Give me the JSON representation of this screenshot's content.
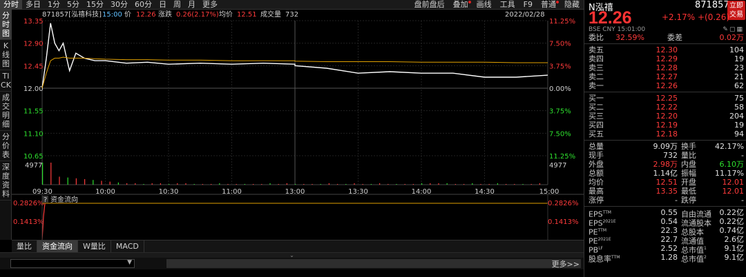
{
  "toolbar": {
    "tabs": [
      "分时",
      "多日",
      "1分",
      "5分",
      "15分",
      "30分",
      "60分",
      "日",
      "周",
      "月",
      "更多"
    ],
    "right": [
      "盘前盘后",
      "叠加",
      "画线",
      "工具",
      "F9",
      "普通",
      "隐藏"
    ]
  },
  "sidebar": [
    "分时图",
    "K线图",
    "TICK",
    "成交明细",
    "分价表",
    "深度资料"
  ],
  "chart_header": {
    "code_name": "871857[泓禧科技]",
    "time": "15:00",
    "price_label": "价",
    "price": "12.26",
    "change_label": "涨跌",
    "change": "0.26(2.17%)",
    "avg_label": "均价",
    "avg": "12.51",
    "vol_label": "成交量",
    "vol": "732",
    "date": "2022/02/28"
  },
  "axes": {
    "price_ticks": [
      "13.35",
      "12.90",
      "12.45",
      "12.00",
      "11.55",
      "11.10",
      "10.65"
    ],
    "pct_ticks": [
      "11.25%",
      "7.50%",
      "3.75%",
      "0.00%",
      "3.75%",
      "7.50%",
      "11.25%"
    ],
    "vol_tick": "4977",
    "time_ticks": [
      "09:30",
      "10:00",
      "10:30",
      "11:00",
      "13:00",
      "13:30",
      "14:00",
      "14:30",
      "15:00"
    ]
  },
  "chart_data": {
    "type": "line",
    "title": "",
    "ylim": [
      10.65,
      13.35
    ],
    "x": [
      "09:30",
      "09:32",
      "09:34",
      "09:36",
      "09:38",
      "09:40",
      "09:43",
      "09:46",
      "09:50",
      "09:55",
      "10:00",
      "10:10",
      "10:20",
      "10:30",
      "10:45",
      "11:00",
      "11:15",
      "11:30",
      "13:00",
      "13:15",
      "13:30",
      "13:45",
      "14:00",
      "14:15",
      "14:30",
      "14:45",
      "15:00"
    ],
    "series": [
      {
        "name": "价",
        "color": "#ffffff",
        "values": [
          12.0,
          12.6,
          13.3,
          12.9,
          12.75,
          12.9,
          12.35,
          12.7,
          12.6,
          12.55,
          12.55,
          12.5,
          12.52,
          12.48,
          12.5,
          12.48,
          12.5,
          12.48,
          12.45,
          12.4,
          12.3,
          12.33,
          12.3,
          12.3,
          12.22,
          12.22,
          12.26
        ]
      },
      {
        "name": "均价",
        "color": "#e0a000",
        "values": [
          12.0,
          12.3,
          12.55,
          12.6,
          12.6,
          12.62,
          12.6,
          12.6,
          12.6,
          12.59,
          12.58,
          12.57,
          12.57,
          12.56,
          12.56,
          12.55,
          12.55,
          12.55,
          12.54,
          12.53,
          12.53,
          12.53,
          12.52,
          12.52,
          12.52,
          12.51,
          12.51
        ]
      }
    ]
  },
  "fund_flow": {
    "help": "?",
    "title": "资金流向",
    "ticks": [
      "0.2826%",
      "0.1413%"
    ]
  },
  "bottom_tabs": [
    "量比",
    "资金流向",
    "W量比",
    "MACD"
  ],
  "bottombar": {
    "more": "更多>>"
  },
  "quote": {
    "name": "N泓禧",
    "code": "871857",
    "btn": "立即交易",
    "price": "12.26",
    "change": "+2.17% +(0.26)",
    "sub": "BSE  CNY  15:01:00",
    "weibi_label": "委比",
    "weibi": "32.59%",
    "weicha_label": "委差",
    "weicha": "0.02万",
    "asks": [
      {
        "label": "卖五",
        "price": "12.30",
        "vol": "104"
      },
      {
        "label": "卖四",
        "price": "12.29",
        "vol": "19"
      },
      {
        "label": "卖三",
        "price": "12.28",
        "vol": "23"
      },
      {
        "label": "卖二",
        "price": "12.27",
        "vol": "21"
      },
      {
        "label": "卖一",
        "price": "12.26",
        "vol": "62"
      }
    ],
    "bids": [
      {
        "label": "买一",
        "price": "12.25",
        "vol": "75"
      },
      {
        "label": "买二",
        "price": "12.22",
        "vol": "58"
      },
      {
        "label": "买三",
        "price": "12.20",
        "vol": "204"
      },
      {
        "label": "买四",
        "price": "12.19",
        "vol": "19"
      },
      {
        "label": "买五",
        "price": "12.18",
        "vol": "94"
      }
    ],
    "stats": [
      {
        "l1": "总量",
        "v1": "9.09万",
        "c1": "white",
        "l2": "换手",
        "v2": "42.17%",
        "c2": "white"
      },
      {
        "l1": "现手",
        "v1": "732",
        "c1": "white",
        "l2": "量比",
        "v2": "-",
        "c2": "white"
      },
      {
        "l1": "外盘",
        "v1": "2.98万",
        "c1": "red",
        "l2": "内盘",
        "v2": "6.10万",
        "c2": "green"
      },
      {
        "l1": "总额",
        "v1": "1.14亿",
        "c1": "white",
        "l2": "振幅",
        "v2": "11.17%",
        "c2": "white"
      },
      {
        "l1": "均价",
        "v1": "12.51",
        "c1": "red",
        "l2": "开盘",
        "v2": "12.01",
        "c2": "red"
      },
      {
        "l1": "最高",
        "v1": "13.35",
        "c1": "red",
        "l2": "最低",
        "v2": "12.01",
        "c2": "red"
      },
      {
        "l1": "涨停",
        "v1": "-",
        "c1": "white",
        "l2": "跌停",
        "v2": "-",
        "c2": "white"
      }
    ],
    "fundamentals": [
      {
        "l1": "EPS",
        "s1": "TTM",
        "v1": "0.55",
        "l2": "自由流通",
        "s2": "",
        "v2": "0.22亿"
      },
      {
        "l1": "EPS",
        "s1": "2021E",
        "v1": "0.54",
        "l2": "流通股本",
        "s2": "",
        "v2": "0.22亿"
      },
      {
        "l1": "PE",
        "s1": "TTM",
        "v1": "22.3",
        "l2": "总股本",
        "s2": "",
        "v2": "0.74亿"
      },
      {
        "l1": "PE",
        "s1": "2021E",
        "v1": "22.7",
        "l2": "流通值",
        "s2": "",
        "v2": "2.6亿"
      },
      {
        "l1": "PB",
        "s1": "LF",
        "v1": "2.52",
        "l2": "总市值",
        "s2": "1",
        "v2": "9.1亿"
      },
      {
        "l1": "股息率",
        "s1": "TTM",
        "v1": "1.28",
        "l2": "总市值",
        "s2": "2",
        "v2": "9.1亿"
      }
    ]
  }
}
